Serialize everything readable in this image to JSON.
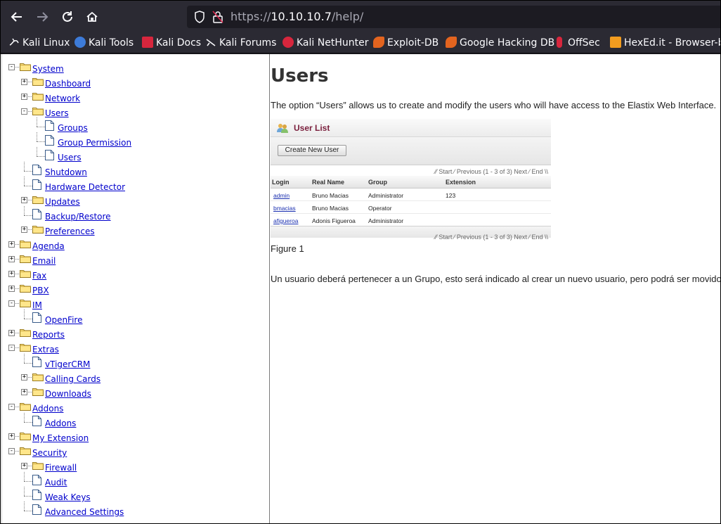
{
  "browser": {
    "url_scheme": "https://",
    "url_host": "10.10.10.7",
    "url_path": "/help/",
    "bookmarks": [
      {
        "label": "Kali Linux",
        "icon": "kali-dragon-icon",
        "color": "#fbfbfe"
      },
      {
        "label": "Kali Tools",
        "icon": "kali-tools-icon",
        "color": "#3d7bd9"
      },
      {
        "label": "Kali Docs",
        "icon": "kali-docs-icon",
        "color": "#d7263d"
      },
      {
        "label": "Kali Forums",
        "icon": "kali-forums-icon",
        "color": "#fbfbfe"
      },
      {
        "label": "Kali NetHunter",
        "icon": "nethunter-icon",
        "color": "#d7263d"
      },
      {
        "label": "Exploit-DB",
        "icon": "exploit-db-icon",
        "color": "#e3641f"
      },
      {
        "label": "Google Hacking DB",
        "icon": "ghdb-icon",
        "color": "#e3641f"
      },
      {
        "label": "OffSec",
        "icon": "offsec-icon",
        "color": "#d7263d"
      },
      {
        "label": "HexEd.it - Browser-b",
        "icon": "hexed-icon",
        "color": "#f29c1f"
      }
    ]
  },
  "tree": [
    {
      "label": "System",
      "level": 0,
      "type": "folder",
      "expander": "−"
    },
    {
      "label": "Dashboard",
      "level": 1,
      "type": "folder",
      "expander": "+"
    },
    {
      "label": "Network",
      "level": 1,
      "type": "folder",
      "expander": "+"
    },
    {
      "label": "Users",
      "level": 1,
      "type": "folder",
      "expander": "−"
    },
    {
      "label": "Groups",
      "level": 2,
      "type": "page"
    },
    {
      "label": "Group Permission",
      "level": 2,
      "type": "page"
    },
    {
      "label": "Users",
      "level": 2,
      "type": "page"
    },
    {
      "label": "Shutdown",
      "level": 1,
      "type": "page"
    },
    {
      "label": "Hardware Detector",
      "level": 1,
      "type": "page"
    },
    {
      "label": "Updates",
      "level": 1,
      "type": "folder",
      "expander": "+"
    },
    {
      "label": "Backup/Restore",
      "level": 1,
      "type": "page"
    },
    {
      "label": "Preferences",
      "level": 1,
      "type": "folder",
      "expander": "+"
    },
    {
      "label": "Agenda",
      "level": 0,
      "type": "folder",
      "expander": "+"
    },
    {
      "label": "Email",
      "level": 0,
      "type": "folder",
      "expander": "+"
    },
    {
      "label": "Fax",
      "level": 0,
      "type": "folder",
      "expander": "+"
    },
    {
      "label": "PBX",
      "level": 0,
      "type": "folder",
      "expander": "+"
    },
    {
      "label": "IM",
      "level": 0,
      "type": "folder",
      "expander": "−"
    },
    {
      "label": "OpenFire",
      "level": 1,
      "type": "page"
    },
    {
      "label": "Reports",
      "level": 0,
      "type": "folder",
      "expander": "+"
    },
    {
      "label": "Extras",
      "level": 0,
      "type": "folder",
      "expander": "−"
    },
    {
      "label": "vTigerCRM",
      "level": 1,
      "type": "page"
    },
    {
      "label": "Calling Cards",
      "level": 1,
      "type": "folder",
      "expander": "+"
    },
    {
      "label": "Downloads",
      "level": 1,
      "type": "folder",
      "expander": "+"
    },
    {
      "label": "Addons",
      "level": 0,
      "type": "folder",
      "expander": "−"
    },
    {
      "label": "Addons",
      "level": 1,
      "type": "page"
    },
    {
      "label": "My Extension",
      "level": 0,
      "type": "folder",
      "expander": "+"
    },
    {
      "label": "Security",
      "level": 0,
      "type": "folder",
      "expander": "−"
    },
    {
      "label": "Firewall",
      "level": 1,
      "type": "folder",
      "expander": "+"
    },
    {
      "label": "Audit",
      "level": 1,
      "type": "page"
    },
    {
      "label": "Weak Keys",
      "level": 1,
      "type": "page"
    },
    {
      "label": "Advanced Settings",
      "level": 1,
      "type": "page"
    }
  ],
  "doc": {
    "title": "Users",
    "intro": "The option “Users” allows us to create and modify the users who will have access to the Elastix Web Interface.",
    "figure_caption": "Figure 1",
    "spanish_para": "Un usuario deberá pertenecer a un Grupo, esto será indicado al crear un nuevo usuario, pero podrá ser movido",
    "figure": {
      "title": "User List",
      "create_button": "Create New User",
      "pager": {
        "start": "Start",
        "info": "Previous (1 - 3 of 3) Next",
        "end": "End"
      },
      "columns": [
        "Login",
        "Real Name",
        "Group",
        "Extension"
      ],
      "rows": [
        [
          "admin",
          "Bruno Macias",
          "Administrator",
          "123"
        ],
        [
          "bmacias",
          "Bruno Macias",
          "Operator",
          ""
        ],
        [
          "afigueroa",
          "Adonis Figueroa",
          "Administrator",
          ""
        ]
      ]
    }
  }
}
